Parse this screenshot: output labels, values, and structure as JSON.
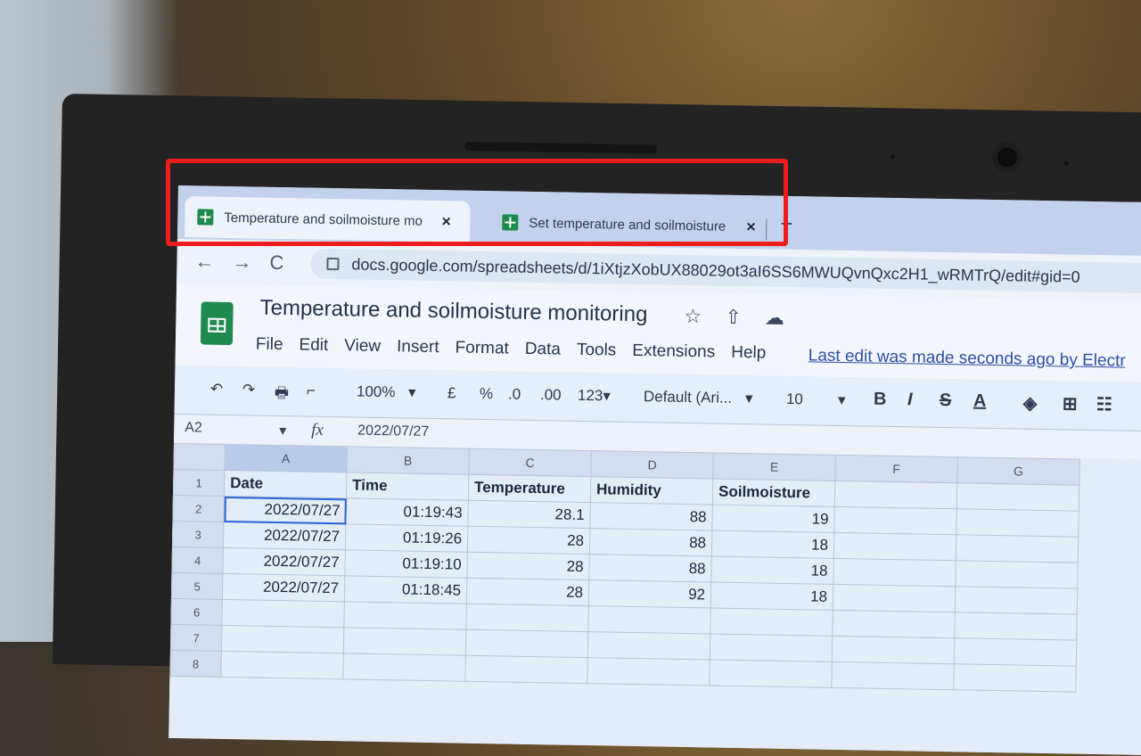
{
  "browser": {
    "tabs": [
      {
        "label": "Temperature and soilmoisture mo",
        "close": "×"
      },
      {
        "label": "Set temperature and soilmoisture",
        "close": "×"
      }
    ],
    "new_tab": "+",
    "nav": {
      "back": "←",
      "forward": "→",
      "reload": "C"
    },
    "url": "docs.google.com/spreadsheets/d/1iXtjzXobUX88029ot3aI6SS6MWUQvnQxc2H1_wRMTrQ/edit#gid=0"
  },
  "sheet": {
    "title": "Temperature and soilmoisture monitoring",
    "header_icons": [
      "☆",
      "⇧",
      "☁"
    ],
    "menu": [
      "File",
      "Edit",
      "View",
      "Insert",
      "Format",
      "Data",
      "Tools",
      "Extensions",
      "Help"
    ],
    "last_edit": "Last edit was made seconds ago by Electr"
  },
  "toolbar": {
    "undo": "↶",
    "redo": "↷",
    "print": "🖶",
    "paint": "⌐",
    "zoom": "100%",
    "zoom_caret": "▾",
    "currency": "£",
    "percent": "%",
    "dec_less": ".0",
    "dec_more": ".00",
    "format": "123▾",
    "font": "Default (Ari...",
    "font_caret": "▾",
    "size": "10",
    "size_caret": "▾",
    "bold": "B",
    "italic": "I",
    "strike": "S",
    "text_color": "A",
    "fill": "◈",
    "borders": "⊞",
    "merge": "☷"
  },
  "formula_bar": {
    "cell_ref": "A2",
    "caret": "▾",
    "fx": "fx",
    "value": "2022/07/27"
  },
  "grid": {
    "columns": [
      "A",
      "B",
      "C",
      "D",
      "E",
      "F",
      "G"
    ],
    "rows": [
      {
        "n": "1",
        "cells": [
          "Date",
          "Time",
          "Temperature",
          "Humidity",
          "Soilmoisture",
          "",
          ""
        ]
      },
      {
        "n": "2",
        "cells": [
          "2022/07/27",
          "01:19:43",
          "28.1",
          "88",
          "19",
          "",
          ""
        ]
      },
      {
        "n": "3",
        "cells": [
          "2022/07/27",
          "01:19:26",
          "28",
          "88",
          "18",
          "",
          ""
        ]
      },
      {
        "n": "4",
        "cells": [
          "2022/07/27",
          "01:19:10",
          "28",
          "88",
          "18",
          "",
          ""
        ]
      },
      {
        "n": "5",
        "cells": [
          "2022/07/27",
          "01:18:45",
          "28",
          "92",
          "18",
          "",
          ""
        ]
      },
      {
        "n": "6",
        "cells": [
          "",
          "",
          "",
          "",
          "",
          "",
          ""
        ]
      },
      {
        "n": "7",
        "cells": [
          "",
          "",
          "",
          "",
          "",
          "",
          ""
        ]
      },
      {
        "n": "8",
        "cells": [
          "",
          "",
          "",
          "",
          "",
          "",
          ""
        ]
      }
    ]
  },
  "colors": {
    "highlight": "#ee1c1c",
    "sheets_green": "#1f8a4e",
    "link": "#2d4fa4"
  }
}
